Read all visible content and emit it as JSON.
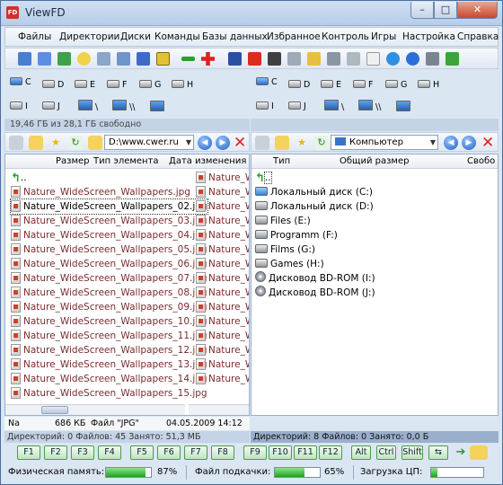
{
  "window": {
    "title": "ViewFD",
    "app_icon": "FD",
    "minimize": "–",
    "maximize": "□",
    "close": "✕"
  },
  "menu": [
    "Файлы",
    "Директории",
    "Диски",
    "Команды",
    "Базы данных",
    "Избранное",
    "Контроль",
    "Игры",
    "Настройка",
    "Справка"
  ],
  "drives_left_row1": [
    "C",
    "D",
    "E",
    "F",
    "G",
    "H"
  ],
  "drives_left_row2": [
    "I",
    "J",
    "\\",
    "\\\\"
  ],
  "drives_right_row1": [
    "C",
    "D",
    "E",
    "F",
    "G",
    "H"
  ],
  "drives_right_row2": [
    "I",
    "J",
    "\\",
    "\\\\"
  ],
  "left": {
    "free_info": "19,46 ГБ из 28,1 ГБ свободно",
    "path": "D:\\www.cwer.ru",
    "columns": {
      "size": "Размер",
      "type": "Тип элемента",
      "date": "Дата изменения"
    },
    "up": "..",
    "files": [
      "Nature_WideScreen_Wallpapers.jpg",
      "Nature_WideScreen_Wallpapers_02.jpg",
      "Nature_WideScreen_Wallpapers_03.jpg",
      "Nature_WideScreen_Wallpapers_04.jpg",
      "Nature_WideScreen_Wallpapers_05.jpg",
      "Nature_WideScreen_Wallpapers_06.jpg",
      "Nature_WideScreen_Wallpapers_07.jpg",
      "Nature_WideScreen_Wallpapers_08.jpg",
      "Nature_WideScreen_Wallpapers_09.jpg",
      "Nature_WideScreen_Wallpapers_10.jpg",
      "Nature_WideScreen_Wallpapers_11.jpg",
      "Nature_WideScreen_Wallpapers_12.jpg",
      "Nature_WideScreen_Wallpapers_13.jpg",
      "Nature_WideScreen_Wallpapers_14.jpg",
      "Nature_WideScreen_Wallpapers_15.jpg"
    ],
    "second_col_label": "Nature_W",
    "status": {
      "name": "Na",
      "size": "686 КБ",
      "type": "Файл \"JPG\"",
      "date": "04.05.2009 14:12"
    },
    "summary": "Директорий: 0   Файлов: 45   Занято: 51,3 МБ"
  },
  "right": {
    "path": "Компьютер",
    "columns": {
      "type": "Тип",
      "total": "Общий размер",
      "free": "Свобо"
    },
    "up": "..",
    "drives": [
      {
        "label": "Локальный диск (C:)",
        "kind": "sys"
      },
      {
        "label": "Локальный диск (D:)",
        "kind": "hdd"
      },
      {
        "label": "Files (E:)",
        "kind": "hdd"
      },
      {
        "label": "Programm (F:)",
        "kind": "hdd"
      },
      {
        "label": "Films (G:)",
        "kind": "hdd"
      },
      {
        "label": "Games (H:)",
        "kind": "hdd"
      },
      {
        "label": "Дисковод BD-ROM (I:)",
        "kind": "cd"
      },
      {
        "label": "Дисковод BD-ROM (J:)",
        "kind": "cd"
      }
    ],
    "summary": "Директорий: 8   Файлов: 0   Занято: 0,0 Б"
  },
  "fkeys": [
    "F1",
    "F2",
    "F3",
    "F4",
    "F5",
    "F6",
    "F7",
    "F8",
    "F9",
    "F10",
    "F11",
    "F12"
  ],
  "modkeys": [
    "Alt",
    "Ctrl",
    "Shift"
  ],
  "memory": {
    "phys_label": "Физическая память:",
    "phys_pct": "87%",
    "phys_value": 0.87,
    "swap_label": "Файл подкачки:",
    "swap_pct": "65%",
    "swap_value": 0.65,
    "cpu_label": "Загрузка ЦП:",
    "cpu_value": 0.12
  }
}
